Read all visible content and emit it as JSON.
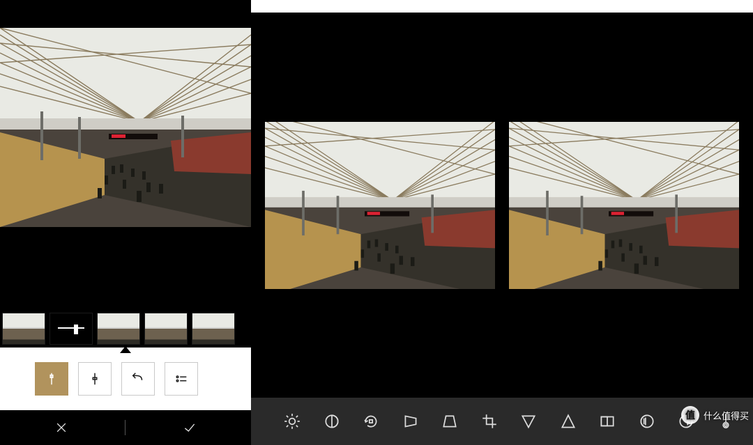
{
  "left_editor": {
    "tools": [
      {
        "name": "adjust-active",
        "icon": "slider-vertical",
        "active": true
      },
      {
        "name": "adjust",
        "icon": "slider-handle"
      },
      {
        "name": "undo",
        "icon": "undo-arrow"
      },
      {
        "name": "presets",
        "icon": "list-dots"
      }
    ],
    "presets_strip": [
      {
        "name": "preset-1"
      },
      {
        "name": "preset-selected",
        "selected": true
      },
      {
        "name": "preset-3"
      },
      {
        "name": "preset-4"
      },
      {
        "name": "preset-5"
      }
    ],
    "confirm": {
      "cancel_icon": "x",
      "accept_icon": "check"
    }
  },
  "right_editor": {
    "tool_icons": [
      "brightness",
      "contrast",
      "rotate",
      "perspective-h",
      "perspective-v",
      "crop-t",
      "invert-triangle",
      "sharpen-triangle",
      "vignette-square",
      "exposure-circle",
      "shadows-circle",
      "temperature"
    ]
  },
  "watermark": {
    "label": "什么值得买",
    "badge": "值"
  }
}
